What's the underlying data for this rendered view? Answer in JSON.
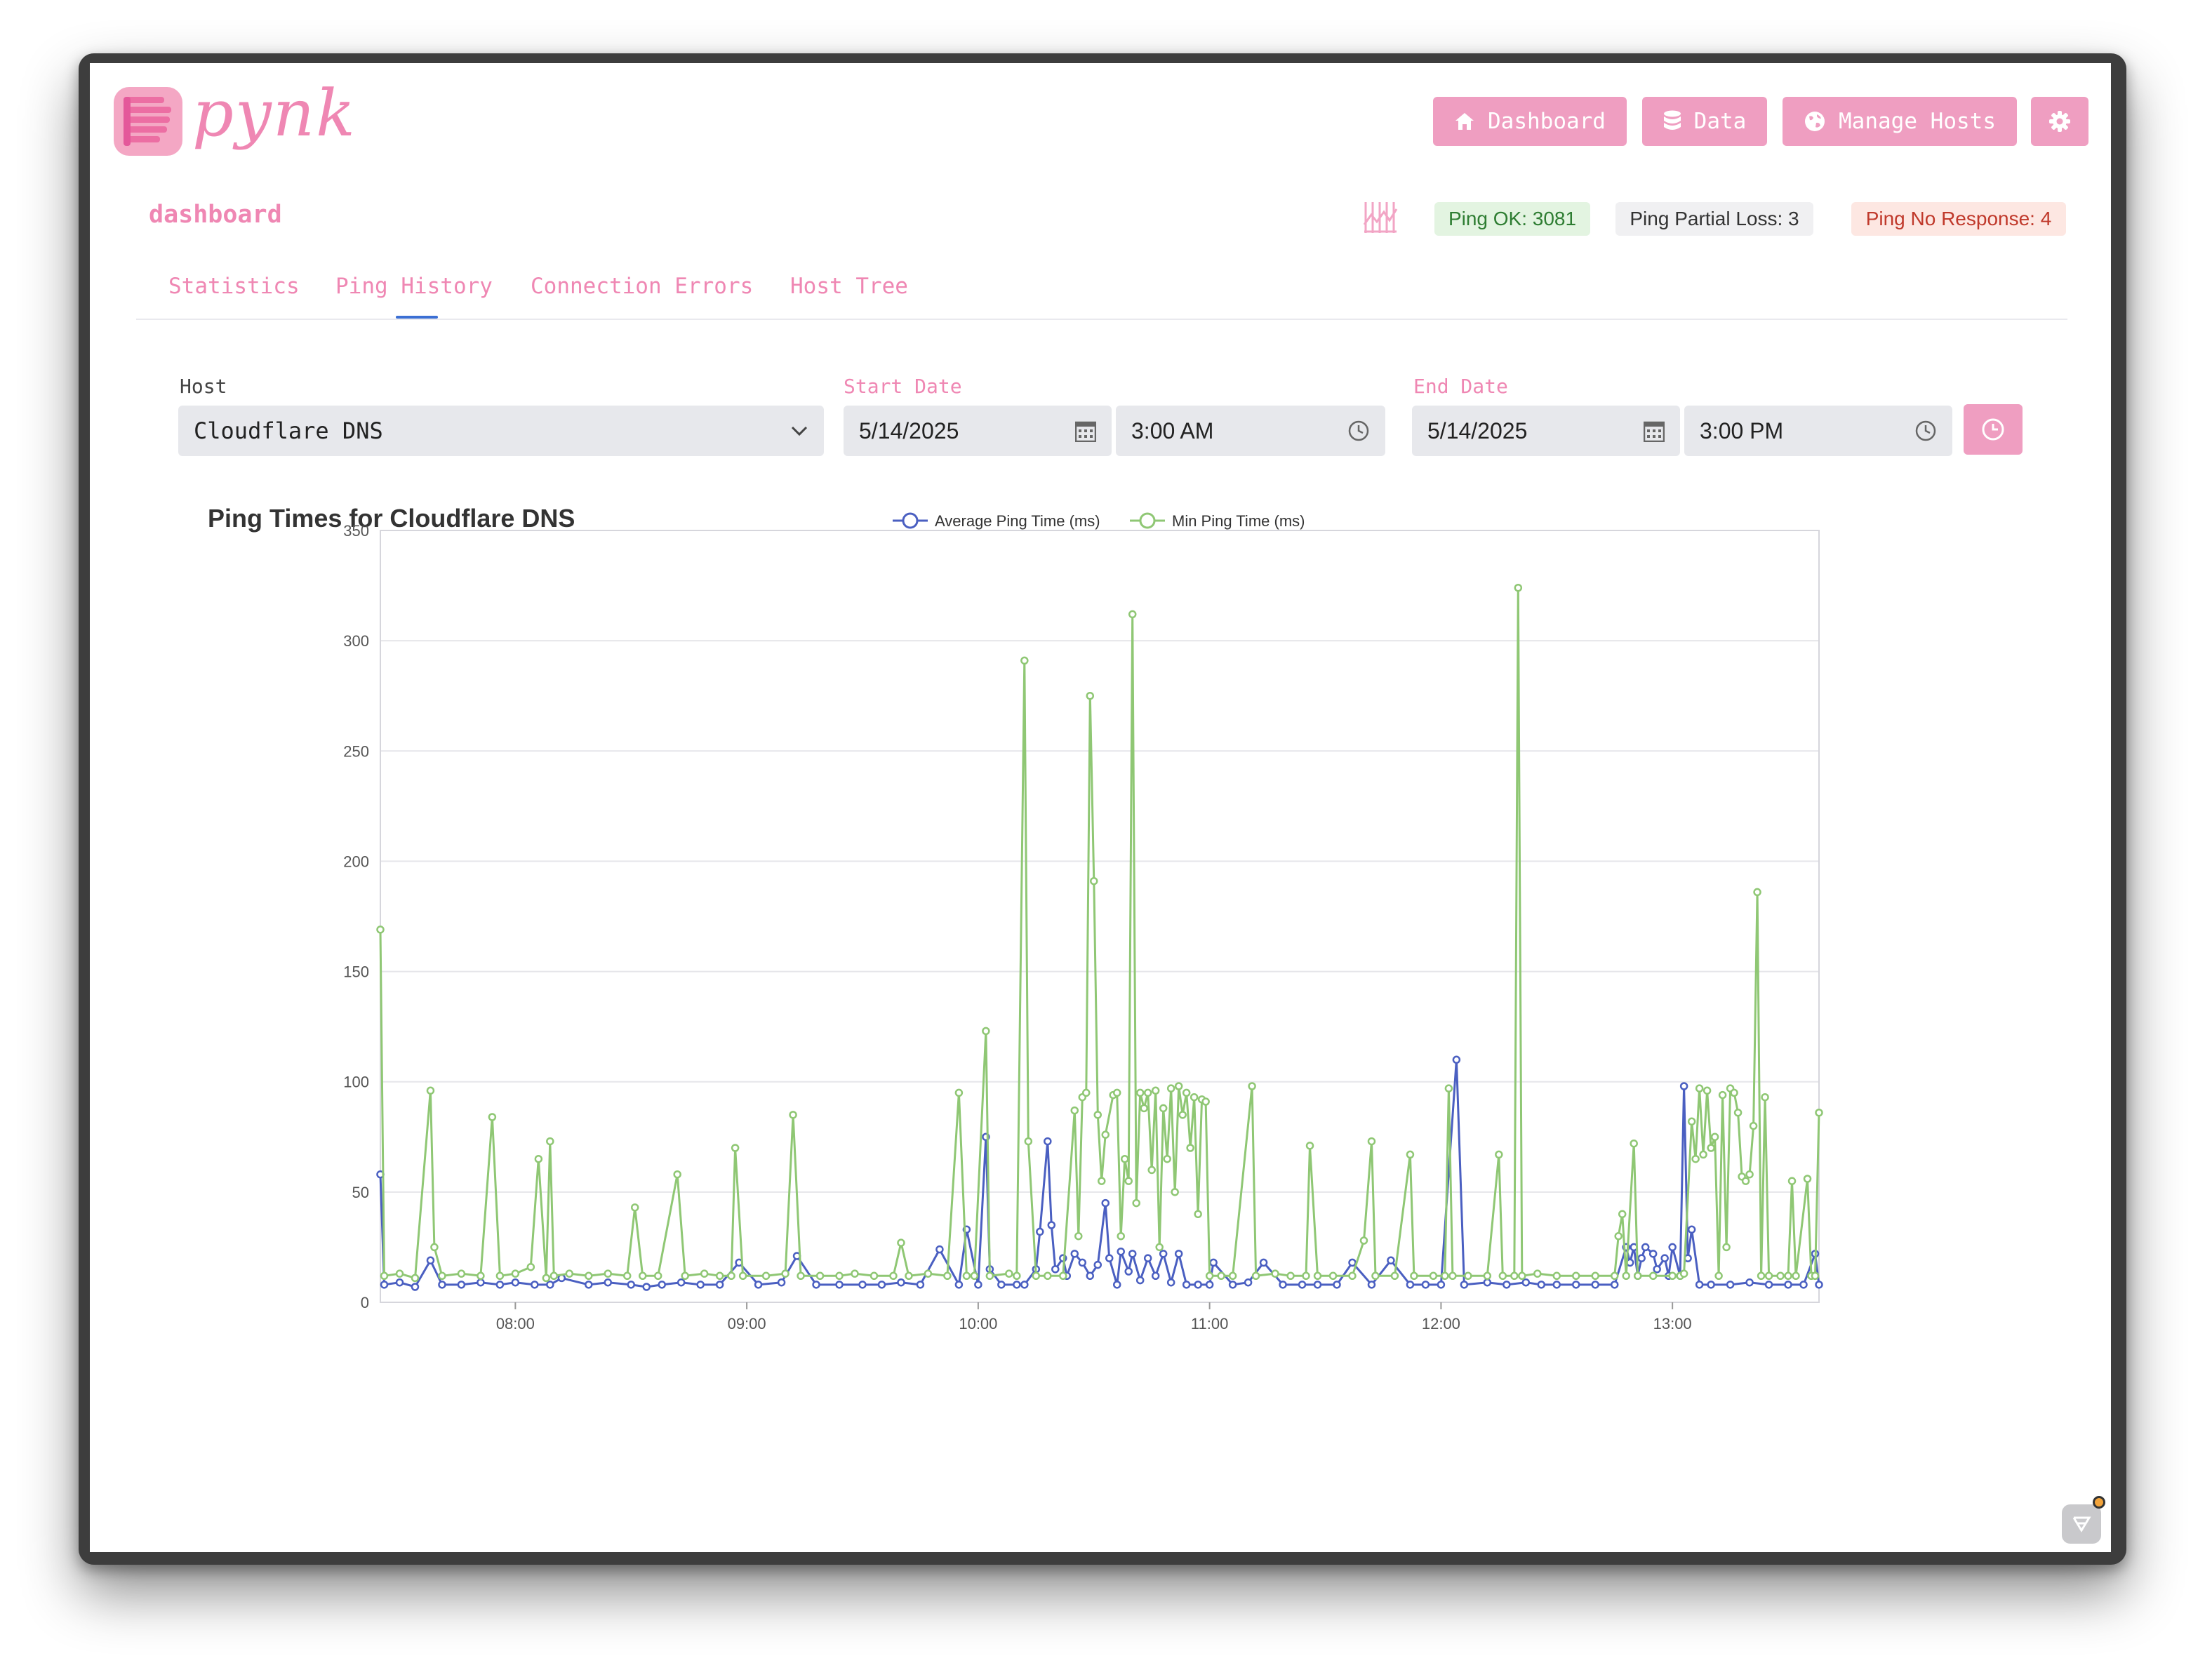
{
  "app": {
    "logo_text": "pynk"
  },
  "nav": {
    "dashboard": "Dashboard",
    "data": "Data",
    "manage_hosts": "Manage Hosts"
  },
  "page_subtitle": "dashboard",
  "status": {
    "ok": "Ping OK: 3081",
    "partial": "Ping Partial Loss: 3",
    "no_response": "Ping No Response: 4"
  },
  "tabs": [
    "Statistics",
    "Ping History",
    "Connection Errors",
    "Host Tree"
  ],
  "active_tab": "Ping History",
  "form": {
    "host_label": "Host",
    "host_value": "Cloudflare DNS",
    "start_label": "Start Date",
    "start_date": "5/14/2025",
    "start_time": "3:00 AM",
    "end_label": "End Date",
    "end_date": "5/14/2025",
    "end_time": "3:00 PM"
  },
  "colors": {
    "brand_pink": "#ef9ec1",
    "avg_series": "#4a5fc1",
    "min_series": "#8fc774"
  },
  "chart_data": {
    "type": "line",
    "title": "Ping Times for Cloudflare DNS",
    "xlabel": "",
    "ylabel": "",
    "ylim": [
      0,
      350
    ],
    "yticks": [
      0,
      50,
      100,
      150,
      200,
      250,
      300,
      350
    ],
    "xlim": [
      "07:25",
      "13:38"
    ],
    "xticks": [
      "08:00",
      "09:00",
      "10:00",
      "11:00",
      "12:00",
      "13:00"
    ],
    "legend_position": "top-center",
    "grid": true,
    "x_format": "HH:MM",
    "series": [
      {
        "name": "Average Ping Time (ms)",
        "color": "#4a5fc1",
        "points": [
          [
            "07:25",
            58
          ],
          [
            "07:26",
            8
          ],
          [
            "07:30",
            9
          ],
          [
            "07:34",
            7
          ],
          [
            "07:38",
            19
          ],
          [
            "07:41",
            8
          ],
          [
            "07:46",
            8
          ],
          [
            "07:51",
            9
          ],
          [
            "07:56",
            8
          ],
          [
            "08:00",
            9
          ],
          [
            "08:05",
            8
          ],
          [
            "08:09",
            8
          ],
          [
            "08:12",
            11
          ],
          [
            "08:19",
            8
          ],
          [
            "08:24",
            9
          ],
          [
            "08:30",
            8
          ],
          [
            "08:34",
            7
          ],
          [
            "08:38",
            8
          ],
          [
            "08:43",
            9
          ],
          [
            "08:48",
            8
          ],
          [
            "08:53",
            8
          ],
          [
            "08:58",
            18
          ],
          [
            "09:03",
            8
          ],
          [
            "09:09",
            9
          ],
          [
            "09:13",
            21
          ],
          [
            "09:18",
            8
          ],
          [
            "09:24",
            8
          ],
          [
            "09:30",
            8
          ],
          [
            "09:35",
            8
          ],
          [
            "09:40",
            9
          ],
          [
            "09:45",
            8
          ],
          [
            "09:50",
            24
          ],
          [
            "09:55",
            8
          ],
          [
            "09:57",
            33
          ],
          [
            "10:00",
            8
          ],
          [
            "10:02",
            75
          ],
          [
            "10:03",
            15
          ],
          [
            "10:06",
            8
          ],
          [
            "10:10",
            8
          ],
          [
            "10:12",
            8
          ],
          [
            "10:15",
            15
          ],
          [
            "10:16",
            32
          ],
          [
            "10:18",
            73
          ],
          [
            "10:19",
            35
          ],
          [
            "10:20",
            15
          ],
          [
            "10:22",
            20
          ],
          [
            "10:23",
            12
          ],
          [
            "10:25",
            22
          ],
          [
            "10:27",
            18
          ],
          [
            "10:29",
            12
          ],
          [
            "10:31",
            17
          ],
          [
            "10:33",
            45
          ],
          [
            "10:34",
            20
          ],
          [
            "10:36",
            8
          ],
          [
            "10:37",
            23
          ],
          [
            "10:39",
            14
          ],
          [
            "10:40",
            22
          ],
          [
            "10:42",
            10
          ],
          [
            "10:44",
            20
          ],
          [
            "10:46",
            12
          ],
          [
            "10:48",
            22
          ],
          [
            "10:50",
            9
          ],
          [
            "10:52",
            22
          ],
          [
            "10:54",
            8
          ],
          [
            "10:57",
            8
          ],
          [
            "11:00",
            8
          ],
          [
            "11:01",
            18
          ],
          [
            "11:06",
            8
          ],
          [
            "11:10",
            9
          ],
          [
            "11:14",
            18
          ],
          [
            "11:19",
            8
          ],
          [
            "11:24",
            8
          ],
          [
            "11:28",
            8
          ],
          [
            "11:33",
            8
          ],
          [
            "11:37",
            18
          ],
          [
            "11:42",
            8
          ],
          [
            "11:47",
            19
          ],
          [
            "11:52",
            8
          ],
          [
            "11:56",
            8
          ],
          [
            "12:00",
            8
          ],
          [
            "12:04",
            110
          ],
          [
            "12:06",
            8
          ],
          [
            "12:12",
            9
          ],
          [
            "12:17",
            8
          ],
          [
            "12:22",
            9
          ],
          [
            "12:26",
            8
          ],
          [
            "12:30",
            8
          ],
          [
            "12:35",
            8
          ],
          [
            "12:40",
            8
          ],
          [
            "12:45",
            8
          ],
          [
            "12:48",
            25
          ],
          [
            "12:49",
            18
          ],
          [
            "12:50",
            25
          ],
          [
            "12:51",
            12
          ],
          [
            "12:52",
            20
          ],
          [
            "12:53",
            25
          ],
          [
            "12:55",
            22
          ],
          [
            "12:56",
            15
          ],
          [
            "12:58",
            20
          ],
          [
            "12:59",
            12
          ],
          [
            "13:00",
            25
          ],
          [
            "13:02",
            12
          ],
          [
            "13:03",
            98
          ],
          [
            "13:04",
            20
          ],
          [
            "13:05",
            33
          ],
          [
            "13:07",
            8
          ],
          [
            "13:10",
            8
          ],
          [
            "13:15",
            8
          ],
          [
            "13:20",
            9
          ],
          [
            "13:25",
            8
          ],
          [
            "13:30",
            8
          ],
          [
            "13:34",
            8
          ],
          [
            "13:37",
            22
          ],
          [
            "13:38",
            8
          ]
        ]
      },
      {
        "name": "Min Ping Time (ms)",
        "color": "#8fc774",
        "points": [
          [
            "07:25",
            169
          ],
          [
            "07:26",
            12
          ],
          [
            "07:30",
            13
          ],
          [
            "07:34",
            11
          ],
          [
            "07:38",
            96
          ],
          [
            "07:39",
            25
          ],
          [
            "07:41",
            12
          ],
          [
            "07:46",
            13
          ],
          [
            "07:51",
            12
          ],
          [
            "07:54",
            84
          ],
          [
            "07:56",
            12
          ],
          [
            "08:00",
            13
          ],
          [
            "08:04",
            16
          ],
          [
            "08:06",
            65
          ],
          [
            "08:08",
            11
          ],
          [
            "08:09",
            73
          ],
          [
            "08:10",
            12
          ],
          [
            "08:14",
            13
          ],
          [
            "08:19",
            12
          ],
          [
            "08:24",
            13
          ],
          [
            "08:29",
            12
          ],
          [
            "08:31",
            43
          ],
          [
            "08:33",
            12
          ],
          [
            "08:37",
            12
          ],
          [
            "08:42",
            58
          ],
          [
            "08:44",
            12
          ],
          [
            "08:49",
            13
          ],
          [
            "08:53",
            12
          ],
          [
            "08:56",
            12
          ],
          [
            "08:57",
            70
          ],
          [
            "08:59",
            12
          ],
          [
            "09:05",
            12
          ],
          [
            "09:10",
            13
          ],
          [
            "09:12",
            85
          ],
          [
            "09:14",
            12
          ],
          [
            "09:19",
            12
          ],
          [
            "09:24",
            12
          ],
          [
            "09:28",
            13
          ],
          [
            "09:33",
            12
          ],
          [
            "09:38",
            12
          ],
          [
            "09:40",
            27
          ],
          [
            "09:42",
            12
          ],
          [
            "09:47",
            13
          ],
          [
            "09:52",
            12
          ],
          [
            "09:55",
            95
          ],
          [
            "09:57",
            12
          ],
          [
            "09:59",
            12
          ],
          [
            "10:02",
            123
          ],
          [
            "10:03",
            12
          ],
          [
            "10:08",
            13
          ],
          [
            "10:10",
            12
          ],
          [
            "10:12",
            291
          ],
          [
            "10:13",
            73
          ],
          [
            "10:15",
            12
          ],
          [
            "10:18",
            12
          ],
          [
            "10:22",
            12
          ],
          [
            "10:25",
            87
          ],
          [
            "10:26",
            30
          ],
          [
            "10:27",
            93
          ],
          [
            "10:28",
            95
          ],
          [
            "10:29",
            275
          ],
          [
            "10:30",
            191
          ],
          [
            "10:31",
            85
          ],
          [
            "10:32",
            55
          ],
          [
            "10:33",
            76
          ],
          [
            "10:35",
            94
          ],
          [
            "10:36",
            95
          ],
          [
            "10:37",
            30
          ],
          [
            "10:38",
            65
          ],
          [
            "10:39",
            55
          ],
          [
            "10:40",
            312
          ],
          [
            "10:41",
            45
          ],
          [
            "10:42",
            95
          ],
          [
            "10:43",
            88
          ],
          [
            "10:44",
            95
          ],
          [
            "10:45",
            60
          ],
          [
            "10:46",
            96
          ],
          [
            "10:47",
            25
          ],
          [
            "10:48",
            88
          ],
          [
            "10:49",
            65
          ],
          [
            "10:50",
            97
          ],
          [
            "10:51",
            50
          ],
          [
            "10:52",
            98
          ],
          [
            "10:53",
            85
          ],
          [
            "10:54",
            95
          ],
          [
            "10:55",
            70
          ],
          [
            "10:56",
            93
          ],
          [
            "10:57",
            40
          ],
          [
            "10:58",
            92
          ],
          [
            "10:59",
            91
          ],
          [
            "11:00",
            12
          ],
          [
            "11:03",
            12
          ],
          [
            "11:06",
            12
          ],
          [
            "11:11",
            98
          ],
          [
            "11:12",
            12
          ],
          [
            "11:17",
            13
          ],
          [
            "11:21",
            12
          ],
          [
            "11:25",
            12
          ],
          [
            "11:26",
            71
          ],
          [
            "11:28",
            12
          ],
          [
            "11:32",
            12
          ],
          [
            "11:37",
            12
          ],
          [
            "11:40",
            28
          ],
          [
            "11:42",
            73
          ],
          [
            "11:43",
            12
          ],
          [
            "11:48",
            12
          ],
          [
            "11:52",
            67
          ],
          [
            "11:53",
            12
          ],
          [
            "11:58",
            12
          ],
          [
            "12:01",
            12
          ],
          [
            "12:02",
            97
          ],
          [
            "12:03",
            12
          ],
          [
            "12:07",
            12
          ],
          [
            "12:12",
            12
          ],
          [
            "12:15",
            67
          ],
          [
            "12:16",
            12
          ],
          [
            "12:19",
            12
          ],
          [
            "12:20",
            324
          ],
          [
            "12:21",
            12
          ],
          [
            "12:25",
            13
          ],
          [
            "12:30",
            12
          ],
          [
            "12:35",
            12
          ],
          [
            "12:40",
            12
          ],
          [
            "12:45",
            12
          ],
          [
            "12:46",
            30
          ],
          [
            "12:47",
            40
          ],
          [
            "12:48",
            12
          ],
          [
            "12:50",
            72
          ],
          [
            "12:51",
            12
          ],
          [
            "12:55",
            12
          ],
          [
            "13:00",
            12
          ],
          [
            "13:02",
            12
          ],
          [
            "13:03",
            13
          ],
          [
            "13:05",
            82
          ],
          [
            "13:06",
            65
          ],
          [
            "13:07",
            97
          ],
          [
            "13:08",
            67
          ],
          [
            "13:09",
            96
          ],
          [
            "13:10",
            70
          ],
          [
            "13:11",
            75
          ],
          [
            "13:12",
            12
          ],
          [
            "13:13",
            94
          ],
          [
            "13:14",
            25
          ],
          [
            "13:15",
            97
          ],
          [
            "13:16",
            95
          ],
          [
            "13:17",
            86
          ],
          [
            "13:18",
            57
          ],
          [
            "13:19",
            55
          ],
          [
            "13:20",
            58
          ],
          [
            "13:21",
            80
          ],
          [
            "13:22",
            186
          ],
          [
            "13:23",
            12
          ],
          [
            "13:24",
            93
          ],
          [
            "13:25",
            12
          ],
          [
            "13:28",
            12
          ],
          [
            "13:30",
            12
          ],
          [
            "13:31",
            55
          ],
          [
            "13:32",
            12
          ],
          [
            "13:35",
            56
          ],
          [
            "13:36",
            12
          ],
          [
            "13:37",
            12
          ],
          [
            "13:38",
            86
          ]
        ]
      }
    ]
  }
}
